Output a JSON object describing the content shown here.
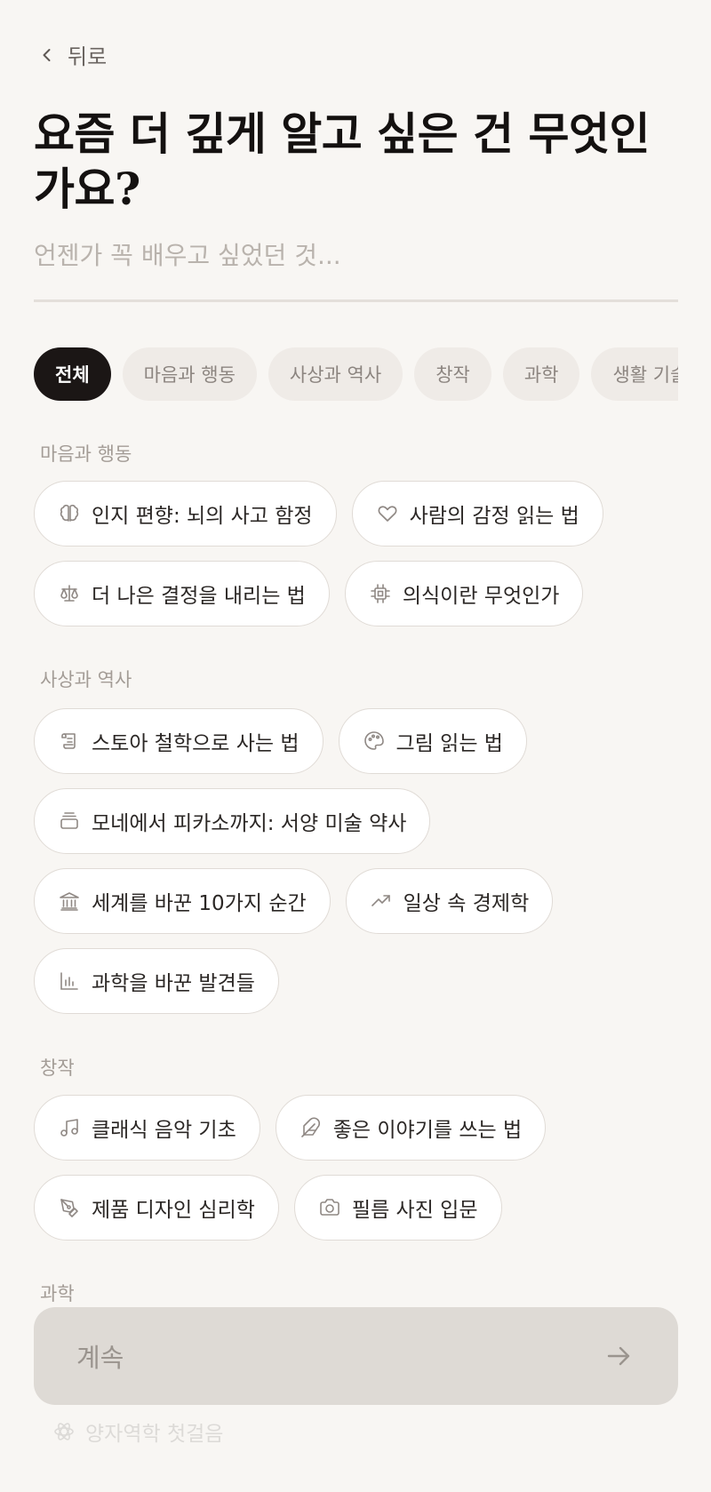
{
  "back": {
    "label": "뒤로",
    "icon": "chevron-left-icon"
  },
  "title": "요즘 더 깊게 알고 싶은 건 무엇인가요?",
  "search": {
    "placeholder": "언젠가 꼭 배우고 싶었던 것...",
    "value": ""
  },
  "tabs": [
    {
      "label": "전체",
      "active": true
    },
    {
      "label": "마음과 행동",
      "active": false
    },
    {
      "label": "사상과 역사",
      "active": false
    },
    {
      "label": "창작",
      "active": false
    },
    {
      "label": "과학",
      "active": false
    },
    {
      "label": "생활 기술",
      "active": false
    }
  ],
  "sections": {
    "mind": {
      "label": "마음과 행동",
      "topics": [
        {
          "label": "인지 편향: 뇌의 사고 함정",
          "icon": "brain-icon"
        },
        {
          "label": "사람의 감정 읽는 법",
          "icon": "heart-icon"
        },
        {
          "label": "더 나은 결정을 내리는 법",
          "icon": "scale-icon"
        },
        {
          "label": "의식이란 무엇인가",
          "icon": "chip-icon"
        }
      ]
    },
    "history": {
      "label": "사상과 역사",
      "topics": [
        {
          "label": "스토아 철학으로 사는 법",
          "icon": "scroll-icon"
        },
        {
          "label": "그림 읽는 법",
          "icon": "palette-icon"
        },
        {
          "label": "모네에서 피카소까지: 서양 미술 약사",
          "icon": "layers-icon"
        },
        {
          "label": "세계를 바꾼 10가지 순간",
          "icon": "landmark-icon"
        },
        {
          "label": "일상 속 경제학",
          "icon": "trend-up-icon"
        },
        {
          "label": "과학을 바꾼 발견들",
          "icon": "bar-chart-icon"
        }
      ]
    },
    "creation": {
      "label": "창작",
      "topics": [
        {
          "label": "클래식 음악 기초",
          "icon": "music-icon"
        },
        {
          "label": "좋은 이야기를 쓰는 법",
          "icon": "feather-icon"
        },
        {
          "label": "제품 디자인 심리학",
          "icon": "pen-tool-icon"
        },
        {
          "label": "필름 사진 입문",
          "icon": "camera-icon"
        }
      ]
    },
    "science": {
      "label": "과학",
      "topics": [
        {
          "label": "양자역학 첫걸음",
          "icon": "atom-icon"
        }
      ]
    }
  },
  "continue_button": {
    "label": "계속",
    "icon": "arrow-right-icon"
  }
}
